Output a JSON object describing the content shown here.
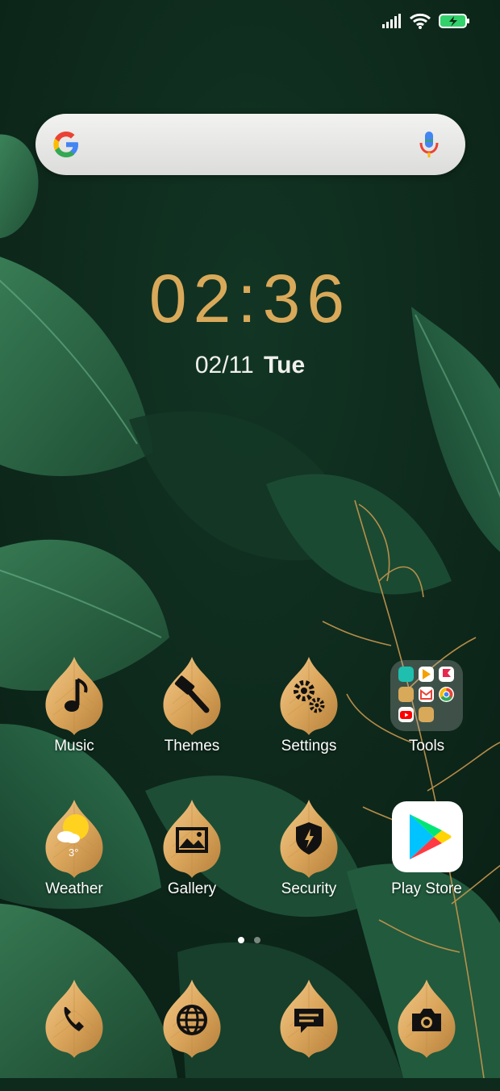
{
  "status_bar": {
    "icons": [
      "signal-icon",
      "wifi-icon",
      "battery-charging-icon"
    ]
  },
  "search_bar": {
    "logo": "google-g-icon",
    "mic": "mic-icon"
  },
  "clock": {
    "time": "02:36",
    "date": "02/11",
    "weekday": "Tue"
  },
  "apps_row1": [
    {
      "label": "Music",
      "icon": "music-note-icon"
    },
    {
      "label": "Themes",
      "icon": "paint-brush-icon"
    },
    {
      "label": "Settings",
      "icon": "gears-icon"
    },
    {
      "label": "Tools",
      "icon": "folder-icon"
    }
  ],
  "apps_row2": [
    {
      "label": "Weather",
      "icon": "weather-sun-icon",
      "temp": "3°"
    },
    {
      "label": "Gallery",
      "icon": "gallery-icon"
    },
    {
      "label": "Security",
      "icon": "shield-icon"
    },
    {
      "label": "Play Store",
      "icon": "play-store-icon"
    }
  ],
  "dock": [
    {
      "icon": "phone-icon"
    },
    {
      "icon": "browser-globe-icon"
    },
    {
      "icon": "messages-icon"
    },
    {
      "icon": "camera-icon"
    }
  ],
  "page_indicator": {
    "pages": 2,
    "current": 1
  },
  "colors": {
    "gold": "#d9a95a",
    "wallpaper_dark": "#0d2a1c",
    "leaf_green": "#2c6e49"
  }
}
